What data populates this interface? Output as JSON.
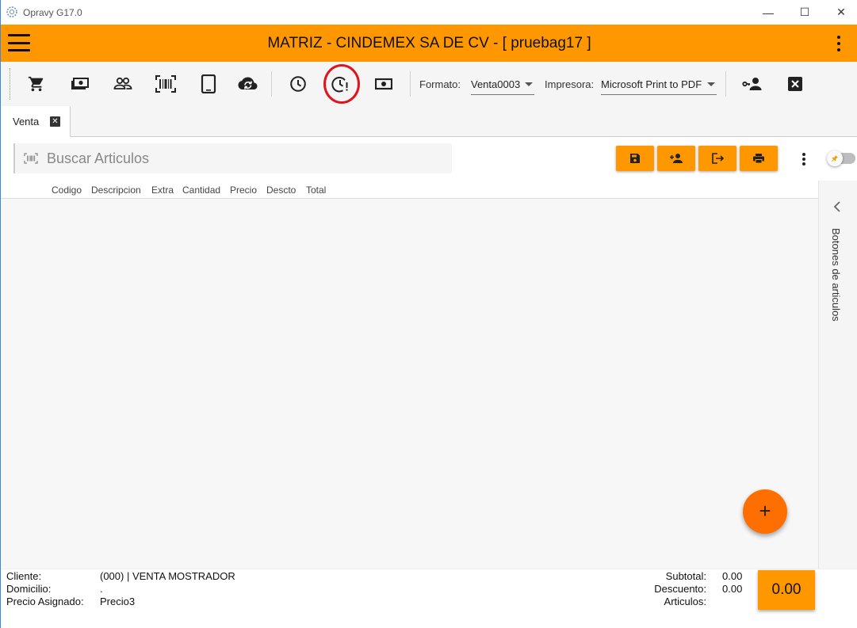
{
  "window": {
    "title": "Opravy G17.0",
    "controls": {
      "minimize": "—",
      "maximize": "☐",
      "close": "✕"
    }
  },
  "appbar": {
    "title": "MATRIZ - CINDEMEX SA DE CV - [ pruebag17 ]"
  },
  "toolbar": {
    "icons": [
      "cart-icon",
      "cash-icon",
      "people-icon",
      "barcode-icon",
      "tablet-icon",
      "cloud-sync-icon",
      "clock-icon",
      "clock-alert-icon",
      "money-icon",
      "user-key-icon",
      "close-box-icon"
    ],
    "formato_label": "Formato:",
    "formato_value": "Venta0003",
    "impresora_label": "Impresora:",
    "impresora_value": "Microsoft Print to PDF"
  },
  "tabs": [
    {
      "label": "Venta"
    }
  ],
  "search": {
    "placeholder": "Buscar Articulos"
  },
  "grid": {
    "columns": [
      "Codigo",
      "Descripcion",
      "Extra",
      "Cantidad",
      "Precio",
      "Descto",
      "Total"
    ]
  },
  "side_panel": {
    "label": "Botones de articulos"
  },
  "fab": {
    "label": "+"
  },
  "footer": {
    "cliente_label": "Cliente:",
    "cliente_value": "(000) | VENTA MOSTRADOR",
    "domicilio_label": "Domicilio:",
    "domicilio_value": ".",
    "precio_label": "Precio Asignado:",
    "precio_value": "Precio3",
    "subtotal_label": "Subtotal:",
    "subtotal_value": "0.00",
    "descuento_label": "Descuento:",
    "descuento_value": "0.00",
    "articulos_label": "Articulos:",
    "total": "0.00"
  },
  "colors": {
    "accent": "#ff9800",
    "fab": "#ff6f00",
    "highlight": "#e0141e"
  }
}
